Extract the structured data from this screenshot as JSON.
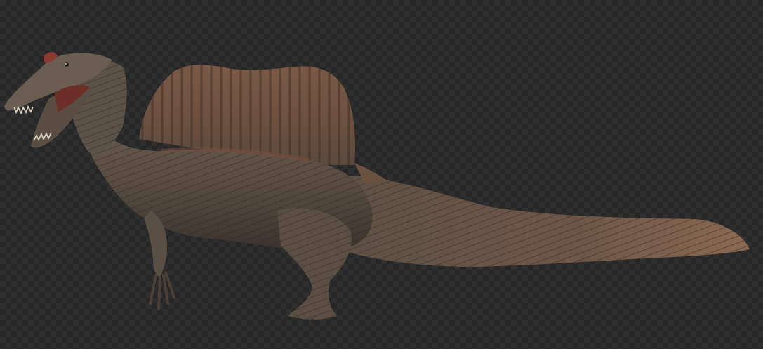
{
  "scene": {
    "subject_icon": "spinosaurus-icon",
    "background": "transparency-checkerboard",
    "colors": {
      "checker_light": "#2f2f2f",
      "checker_dark": "#262626",
      "sail_base": "#6e5243",
      "sail_ridge": "#4a3528",
      "body_base": "#5c5248",
      "body_shadow": "#2e2a26",
      "belly": "#6b5a4c",
      "snout_red": "#8a3a2e",
      "teeth": "#d8cfbf",
      "tail_tip": "#7a5a45"
    }
  }
}
